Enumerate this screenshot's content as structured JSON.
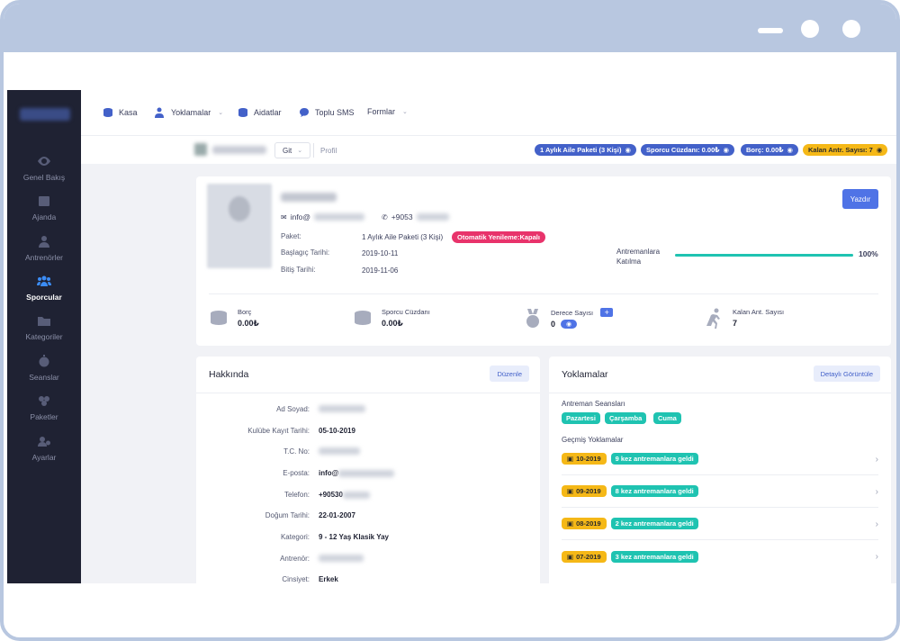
{
  "sidebar": {
    "items": [
      {
        "label": "Genel Bakış",
        "icon": "eye-icon"
      },
      {
        "label": "Ajanda",
        "icon": "calendar-icon"
      },
      {
        "label": "Antrenörler",
        "icon": "user-icon"
      },
      {
        "label": "Sporcular",
        "icon": "users-icon"
      },
      {
        "label": "Kategoriler",
        "icon": "folder-icon"
      },
      {
        "label": "Seanslar",
        "icon": "stopwatch-icon"
      },
      {
        "label": "Paketler",
        "icon": "packages-icon"
      },
      {
        "label": "Ayarlar",
        "icon": "settings-icon"
      }
    ],
    "active_index": 3,
    "accent_color": "#3b8cf5"
  },
  "topnav": {
    "kasa": "Kasa",
    "yoklamalar": "Yoklamalar",
    "aidatlar": "Aidatlar",
    "toplu_sms": "Toplu SMS",
    "formlar": "Formlar"
  },
  "subheader": {
    "git": "Git",
    "profil": "Profil",
    "pills": {
      "package": "1 Aylık Aile Paketi (3 Kişi)",
      "wallet": "Sporcu Cüzdanı: 0.00₺",
      "debt": "Borç: 0.00₺",
      "remaining": "Kalan Antr. Sayısı: 7"
    }
  },
  "profile": {
    "email_prefix": "info@",
    "phone_prefix": "+9053",
    "paket_label": "Paket:",
    "paket_value": "1 Aylık Aile Paketi (3 Kişi)",
    "auto_renew": "Otomatik Yenileme:Kapalı",
    "start_label": "Başlagıç Tarihi:",
    "start_value": "2019-10-11",
    "end_label": "Bitiş Tarihi:",
    "end_value": "2019-11-06",
    "print": "Yazdır",
    "attendance_label": "Antremanlara Katılma",
    "attendance_pct_text": "100%",
    "attendance_fraction": 1.0,
    "stats": {
      "debt_title": "Borç",
      "debt_value": "0.00₺",
      "wallet_title": "Sporcu Cüzdanı",
      "wallet_value": "0.00₺",
      "degree_title": "Derece Sayısı",
      "degree_value": "0",
      "degree_plus": "+",
      "remaining_title": "Kalan Ant. Sayısı",
      "remaining_value": "7"
    }
  },
  "about": {
    "title": "Hakkında",
    "edit": "Düzenle",
    "rows": [
      {
        "label": "Ad Soyad:",
        "value": ""
      },
      {
        "label": "Kulübe Kayıt Tarihi:",
        "value": "05-10-2019"
      },
      {
        "label": "T.C. No:",
        "value": ""
      },
      {
        "label": "E-posta:",
        "value": "info@"
      },
      {
        "label": "Telefon:",
        "value": "+90530"
      },
      {
        "label": "Doğum Tarihi:",
        "value": "22-01-2007"
      },
      {
        "label": "Kategori:",
        "value": "9 - 12 Yaş Klasik Yay"
      },
      {
        "label": "Antrenör:",
        "value": ""
      },
      {
        "label": "Cinsiyet:",
        "value": "Erkek"
      }
    ]
  },
  "attendance": {
    "title": "Yoklamalar",
    "details": "Detaylı Görüntüle",
    "sessions_label": "Antreman Seansları",
    "sessions": [
      "Pazartesi",
      "Çarşamba",
      "Cuma"
    ],
    "history_label": "Geçmiş Yoklamalar",
    "history": [
      {
        "month": "10-2019",
        "text": "9 kez antremanlara geldi"
      },
      {
        "month": "09-2019",
        "text": "8 kez antremanlara geldi"
      },
      {
        "month": "08-2019",
        "text": "2 kez antremanlara geldi"
      },
      {
        "month": "07-2019",
        "text": "3 kez antremanlara geldi"
      }
    ]
  }
}
